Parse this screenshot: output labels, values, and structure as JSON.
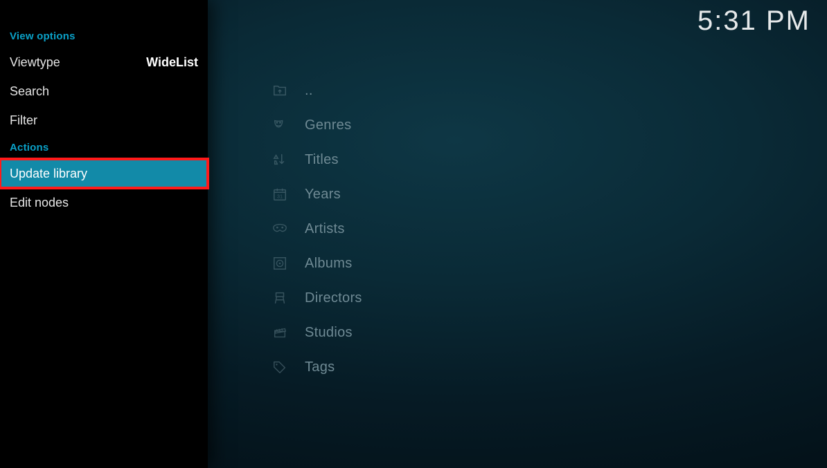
{
  "clock": "5:31 PM",
  "sidebar": {
    "section_view": "View options",
    "viewtype_label": "Viewtype",
    "viewtype_value": "WideList",
    "search_label": "Search",
    "filter_label": "Filter",
    "section_actions": "Actions",
    "update_library_label": "Update library",
    "edit_nodes_label": "Edit nodes"
  },
  "main": {
    "items": [
      {
        "icon": "folder-up-icon",
        "label": ".."
      },
      {
        "icon": "masks-icon",
        "label": "Genres"
      },
      {
        "icon": "sort-icon",
        "label": "Titles"
      },
      {
        "icon": "calendar-icon",
        "label": "Years"
      },
      {
        "icon": "eyemask-icon",
        "label": "Artists"
      },
      {
        "icon": "disc-icon",
        "label": "Albums"
      },
      {
        "icon": "chair-icon",
        "label": "Directors"
      },
      {
        "icon": "clapper-icon",
        "label": "Studios"
      },
      {
        "icon": "tag-icon",
        "label": "Tags"
      }
    ]
  }
}
